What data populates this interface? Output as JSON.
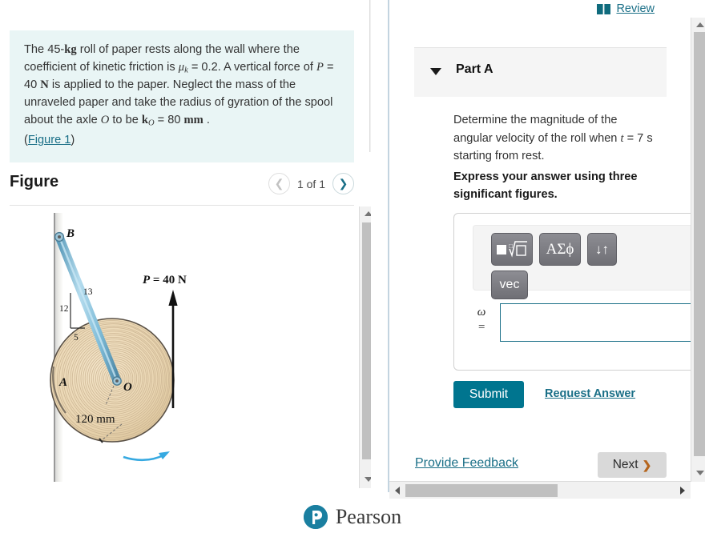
{
  "statement": {
    "text_parts": {
      "p1": "The 45-",
      "kg": "kg",
      "p2": " roll of paper rests along the wall where the coefficient of kinetic friction is ",
      "mu": "μ",
      "mu_sub": "k",
      "p3": " = 0.2. A vertical force of ",
      "P": "P",
      "p4": " = 40 ",
      "N": "N",
      "p5": " is applied to the paper. Neglect the mass of the unraveled paper and take the radius of gyration of the spool about the axle ",
      "O": "O",
      "p6": " to be ",
      "k": "k",
      "k_sub": "O",
      "p7": " = 80  ",
      "mm": "mm",
      "p8": " ."
    },
    "figure_link": "Figure 1",
    "open_paren": "(",
    "close_paren": ")"
  },
  "figure": {
    "title": "Figure",
    "counter": "1 of 1",
    "prev_icon": "chevron-left-icon",
    "next_icon": "chevron-right-icon",
    "labels": {
      "B": "B",
      "A": "A",
      "O": "O",
      "force": "P = 40 N",
      "radius": "120 mm",
      "tri_12": "12",
      "tri_13": "13",
      "tri_5": "5"
    }
  },
  "review": {
    "icon": "book-icon",
    "label": "Review"
  },
  "part": {
    "caret_icon": "caret-down-icon",
    "title": "Part A",
    "question": "Determine the magnitude of the angular velocity of the roll when ",
    "question_t": "t",
    "question_eq": " = 7  s starting from rest.",
    "instruction": "Express your answer using three significant figures."
  },
  "answer": {
    "toolbar": [
      {
        "name": "template-root-button",
        "label": "√"
      },
      {
        "name": "greek-symbols-button",
        "label": "ΑΣϕ"
      },
      {
        "name": "undo-redo-button",
        "label": "↓↑"
      },
      {
        "name": "vector-button",
        "label": "vec"
      }
    ],
    "variable": "ω",
    "equals": "=",
    "value": "",
    "placeholder": ""
  },
  "actions": {
    "submit": "Submit",
    "request_answer": "Request Answer",
    "provide_feedback": "Provide Feedback",
    "next": "Next",
    "next_chevron": "❯"
  },
  "footer": {
    "logo_letter": "P",
    "brand": "Pearson"
  },
  "colors": {
    "accent_teal": "#00758f",
    "link_teal": "#1a6f87",
    "statement_bg": "#e9f5f5",
    "part_band_bg": "#f5f5f5",
    "next_btn_bg": "#d9d9d9",
    "paper_tan": "#e8d5b0",
    "strut_blue": "#8fc5dd"
  }
}
